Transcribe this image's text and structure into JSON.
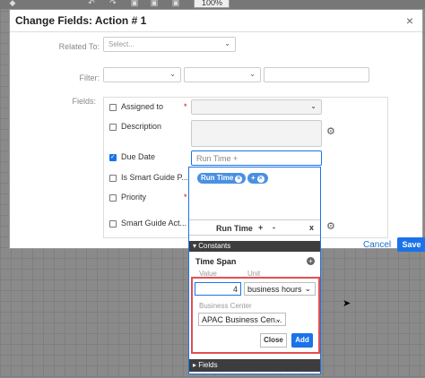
{
  "toolbar": {
    "zoom": "100%"
  },
  "modal": {
    "title": "Change Fields: Action # 1",
    "close_icon": "close-icon",
    "related_to": {
      "label": "Related To:",
      "placeholder": "Select..."
    },
    "filter": {
      "label": "Filter:"
    },
    "fields_label": "Fields:",
    "fields": [
      {
        "label": "Assigned to",
        "checked": false,
        "required": true
      },
      {
        "label": "Description",
        "checked": false,
        "required": false
      },
      {
        "label": "Due Date",
        "checked": true,
        "required": false
      },
      {
        "label": "Is Smart Guide P...",
        "checked": false,
        "required": false
      },
      {
        "label": "Priority",
        "checked": false,
        "required": true
      },
      {
        "label": "Smart Guide Act...",
        "checked": false,
        "required": false
      }
    ],
    "due_date_input": "Run Time +",
    "cancel_label": "Cancel",
    "save_label": "Save"
  },
  "popover": {
    "chips": [
      "Run Time",
      "+"
    ],
    "bar_label": "Run Time",
    "plus": "+",
    "minus": "-",
    "close": "x",
    "constants_header": "Constants",
    "time_span": {
      "title": "Time Span",
      "value_label": "Value",
      "unit_label": "Unit",
      "value": "4",
      "unit": "business hours",
      "business_center_label": "Business Center",
      "business_center": "APAC Business Cen..."
    },
    "close_button": "Close",
    "add_button": "Add",
    "fields_header": "Fields"
  },
  "colors": {
    "accent": "#1a73e8",
    "highlight_border": "#e05050",
    "section_header": "#3d3d3d"
  }
}
